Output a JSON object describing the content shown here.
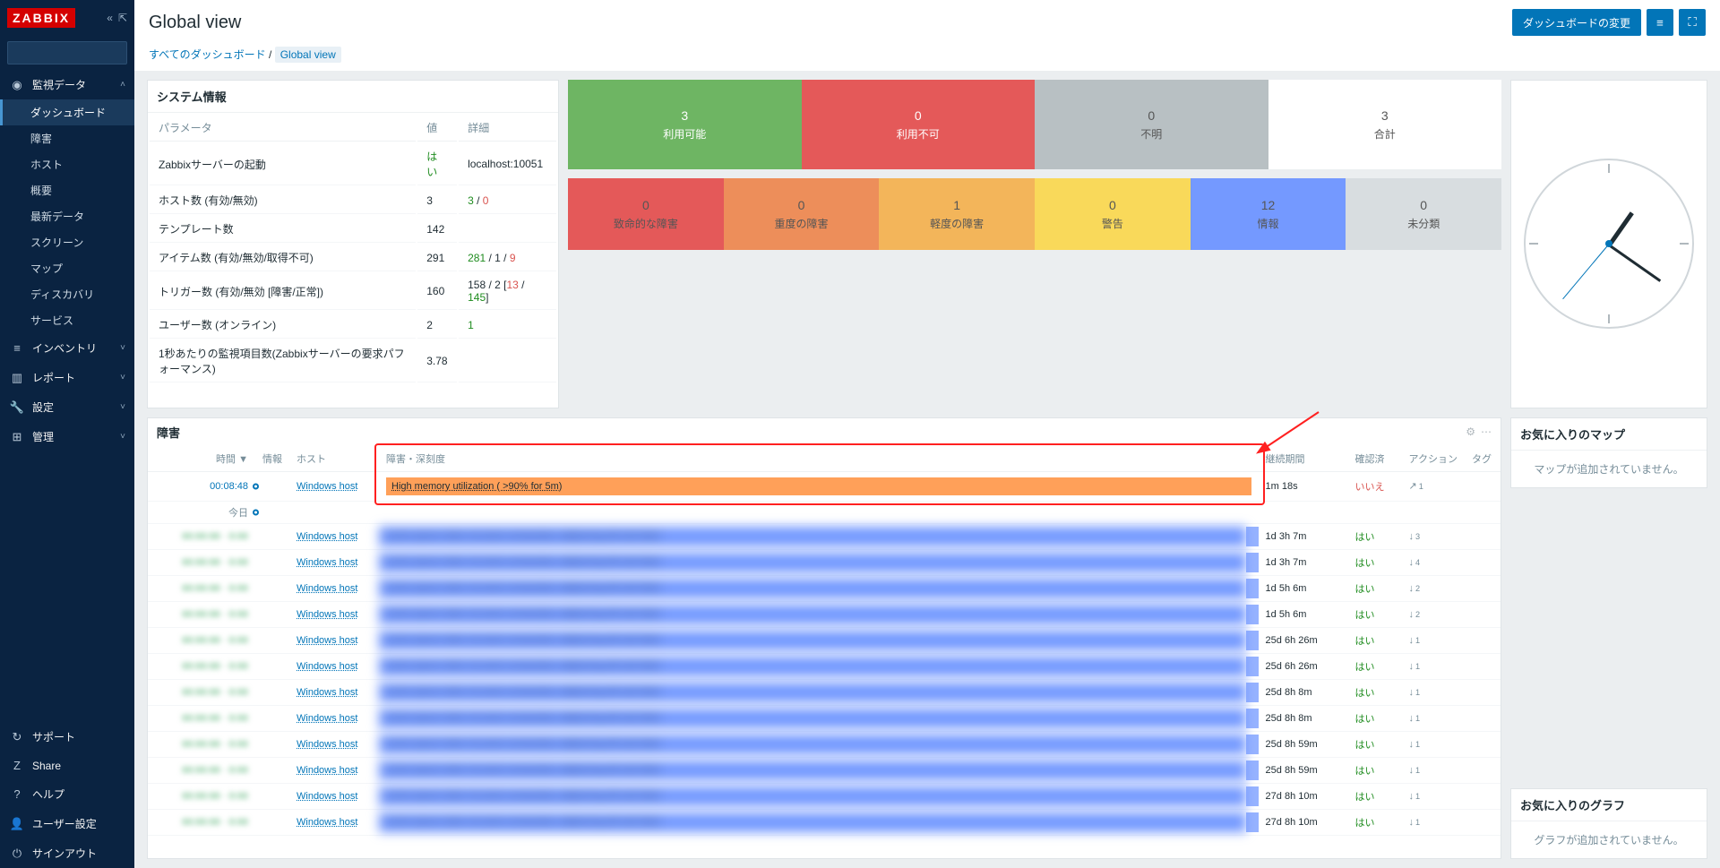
{
  "app": {
    "logo": "ZABBIX"
  },
  "page": {
    "title": "Global view",
    "edit_button": "ダッシュボードの変更",
    "breadcrumb_all": "すべてのダッシュボード",
    "breadcrumb_current": "Global view"
  },
  "sidebar": {
    "sections": [
      {
        "icon": "◉",
        "label": "監視データ",
        "expanded": true,
        "items": [
          "ダッシュボード",
          "障害",
          "ホスト",
          "概要",
          "最新データ",
          "スクリーン",
          "マップ",
          "ディスカバリ",
          "サービス"
        ],
        "active": 0
      },
      {
        "icon": "≡",
        "label": "インベントリ"
      },
      {
        "icon": "▥",
        "label": "レポート"
      },
      {
        "icon": "🔧",
        "label": "設定"
      },
      {
        "icon": "⊞",
        "label": "管理"
      }
    ],
    "bottom": [
      {
        "icon": "↻",
        "label": "サポート"
      },
      {
        "icon": "Z",
        "label": "Share"
      },
      {
        "icon": "?",
        "label": "ヘルプ"
      },
      {
        "icon": "👤",
        "label": "ユーザー設定"
      },
      {
        "icon": "⏻",
        "label": "サインアウト"
      }
    ]
  },
  "sysinfo": {
    "title": "システム情報",
    "headers": [
      "パラメータ",
      "値",
      "詳細"
    ],
    "rows": [
      {
        "p": "Zabbixサーバーの起動",
        "v": "はい",
        "vcls": "green",
        "d": "localhost:10051"
      },
      {
        "p": "ホスト数 (有効/無効)",
        "v": "3",
        "d_html": "<span class='green'>3</span> / <span class='red'>0</span>"
      },
      {
        "p": "テンプレート数",
        "v": "142",
        "d": ""
      },
      {
        "p": "アイテム数 (有効/無効/取得不可)",
        "v": "291",
        "d_html": "<span class='green'>281</span> / <span>1</span> / <span class='red'>9</span>"
      },
      {
        "p": "トリガー数 (有効/無効 [障害/正常])",
        "v": "160",
        "d_html": "158 / 2 [<span class='red'>13</span> / <span class='green'>145</span>]"
      },
      {
        "p": "ユーザー数 (オンライン)",
        "v": "2",
        "d_html": "<span class='green'>1</span>"
      },
      {
        "p": "1秒あたりの監視項目数(Zabbixサーバーの要求パフォーマンス)",
        "v": "3.78",
        "d": ""
      }
    ]
  },
  "hosts_tiles": [
    {
      "num": "3",
      "label": "利用可能",
      "bg": "#6eb563",
      "fg": "#fff"
    },
    {
      "num": "0",
      "label": "利用不可",
      "bg": "#e45959",
      "fg": "#fff"
    },
    {
      "num": "0",
      "label": "不明",
      "bg": "#b8c0c3",
      "fg": "#555"
    },
    {
      "num": "3",
      "label": "合計",
      "bg": "#ffffff",
      "fg": "#555"
    }
  ],
  "sev_tiles": [
    {
      "num": "0",
      "label": "致命的な障害",
      "bg": "#e45959"
    },
    {
      "num": "0",
      "label": "重度の障害",
      "bg": "#ed8e5a"
    },
    {
      "num": "1",
      "label": "軽度の障害",
      "bg": "#f3b55a"
    },
    {
      "num": "0",
      "label": "警告",
      "bg": "#f9d95a"
    },
    {
      "num": "12",
      "label": "情報",
      "bg": "#7499ff"
    },
    {
      "num": "0",
      "label": "未分類",
      "bg": "#d8dde0"
    }
  ],
  "problems": {
    "title": "障害",
    "columns": [
      "時間 ▼",
      "情報",
      "ホスト",
      "障害・深刻度",
      "継続期間",
      "確認済",
      "アクション",
      "タグ"
    ],
    "highlighted": {
      "time": "00:08:48",
      "host": "Windows host",
      "problem": "High memory utilization ( >90% for 5m)",
      "dur": "1m 18s",
      "ack": "いいえ",
      "actcnt": "1"
    },
    "today": "今日",
    "rows": [
      {
        "host": "Windows host",
        "dur": "1d 3h 7m",
        "ack": "はい",
        "actcnt": "3"
      },
      {
        "host": "Windows host",
        "dur": "1d 3h 7m",
        "ack": "はい",
        "actcnt": "4"
      },
      {
        "host": "Windows host",
        "dur": "1d 5h 6m",
        "ack": "はい",
        "actcnt": "2"
      },
      {
        "host": "Windows host",
        "dur": "1d 5h 6m",
        "ack": "はい",
        "actcnt": "2"
      },
      {
        "host": "Windows host",
        "dur": "25d 6h 26m",
        "ack": "はい",
        "actcnt": "1"
      },
      {
        "host": "Windows host",
        "dur": "25d 6h 26m",
        "ack": "はい",
        "actcnt": "1"
      },
      {
        "host": "Windows host",
        "dur": "25d 8h 8m",
        "ack": "はい",
        "actcnt": "1"
      },
      {
        "host": "Windows host",
        "dur": "25d 8h 8m",
        "ack": "はい",
        "actcnt": "1"
      },
      {
        "host": "Windows host",
        "dur": "25d 8h 59m",
        "ack": "はい",
        "actcnt": "1"
      },
      {
        "host": "Windows host",
        "dur": "25d 8h 59m",
        "ack": "はい",
        "actcnt": "1"
      },
      {
        "host": "Windows host",
        "dur": "27d 8h 10m",
        "ack": "はい",
        "actcnt": "1"
      },
      {
        "host": "Windows host",
        "dur": "27d 8h 10m",
        "ack": "はい",
        "actcnt": "1"
      }
    ]
  },
  "fav": {
    "maps_title": "お気に入りのマップ",
    "maps_empty": "マップが追加されていません。",
    "graphs_title": "お気に入りのグラフ",
    "graphs_empty": "グラフが追加されていません。"
  }
}
